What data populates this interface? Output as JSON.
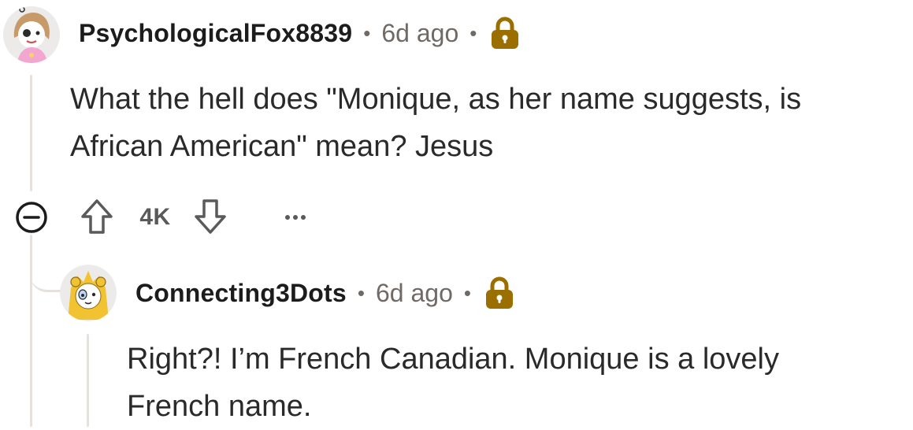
{
  "comments": [
    {
      "username": "PsychologicalFox8839",
      "separator": "•",
      "time": "6d ago",
      "body_lines": [
        "What the hell does \"Monique, as her name suggests, is",
        "African American\" mean? Jesus"
      ],
      "score": "4K",
      "more_label": "…",
      "lock_color": "#9b6e00"
    },
    {
      "username": "Connecting3Dots",
      "separator": "•",
      "time": "6d ago",
      "body_lines": [
        "Right?! I’m French Canadian. Monique is a lovely",
        "French name."
      ],
      "lock_color": "#9b6e00"
    }
  ],
  "colors": {
    "thread_line": "#e5e1dc",
    "meta_text": "#6f6a66",
    "icon_stroke": "#5a5a5a"
  }
}
